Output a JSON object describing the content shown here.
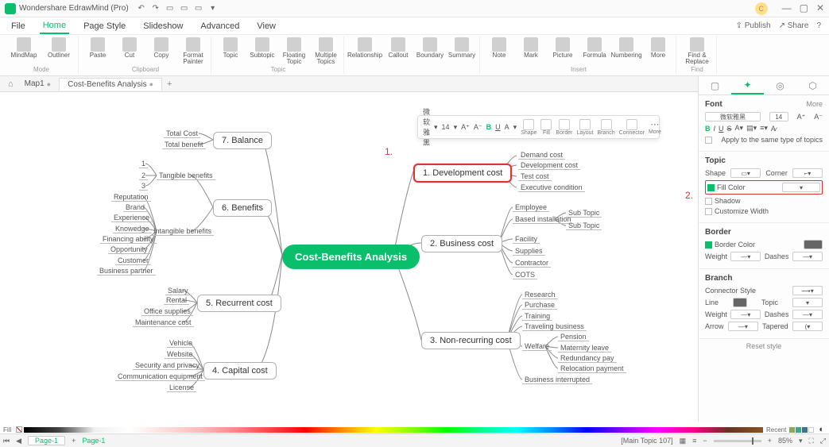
{
  "app": {
    "title": "Wondershare EdrawMind (Pro)"
  },
  "menu": {
    "file": "File",
    "home": "Home",
    "page_style": "Page Style",
    "slideshow": "Slideshow",
    "advanced": "Advanced",
    "view": "View",
    "publish": "Publish",
    "share": "Share"
  },
  "ribbon": {
    "mode": "Mode",
    "mindmap": "MindMap",
    "outliner": "Outliner",
    "clipboard": "Clipboard",
    "paste": "Paste",
    "cut": "Cut",
    "copy": "Copy",
    "format_painter": "Format Painter",
    "topic_group": "Topic",
    "topic": "Topic",
    "subtopic": "Subtopic",
    "floating": "Floating Topic",
    "multiple": "Multiple Topics",
    "relationship": "Relationship",
    "callout": "Callout",
    "boundary": "Boundary",
    "summary": "Summary",
    "insert": "Insert",
    "note": "Note",
    "mark": "Mark",
    "picture": "Picture",
    "formula": "Formula",
    "numbering": "Numbering",
    "more": "More",
    "find": "Find",
    "find_replace": "Find & Replace"
  },
  "tabs": {
    "map1": "Map1",
    "cba": "Cost-Benefits Analysis"
  },
  "float": {
    "font": "微软雅黑",
    "size": "14",
    "shape": "Shape",
    "fill": "Fill",
    "border": "Border",
    "layout": "Layout",
    "branch": "Branch",
    "connector": "Connector",
    "more": "More"
  },
  "rp": {
    "font": "Font",
    "more": "More",
    "font_name": "微软雅黑",
    "font_size": "14",
    "apply_same": "Apply to the same type of topics",
    "topic": "Topic",
    "shape": "Shape",
    "corner": "Corner",
    "fill_color": "Fill Color",
    "shadow": "Shadow",
    "customize_width": "Customize Width",
    "border": "Border",
    "border_color": "Border Color",
    "weight": "Weight",
    "dashes": "Dashes",
    "branch": "Branch",
    "connector_style": "Connector Style",
    "line": "Line",
    "topic_lbl": "Topic",
    "arrow": "Arrow",
    "tapered": "Tapered",
    "reset": "Reset style"
  },
  "annot": {
    "n1": "1.",
    "n2": "2."
  },
  "mm": {
    "root": "Cost-Benefits Analysis",
    "r1": "1. Development cost",
    "r1a": "Demand cost",
    "r1b": "Development cost",
    "r1c": "Test cost",
    "r1d": "Executive condition",
    "r2": "2. Business cost",
    "r2a": "Employee",
    "r2b": "Based installation",
    "r2b1": "Sub Topic",
    "r2b2": "Sub Topic",
    "r2c": "Facility",
    "r2d": "Supplies",
    "r2e": "Contractor",
    "r2f": "COTS",
    "r3": "3. Non-recurring cost",
    "r3a": "Research",
    "r3b": "Purchase",
    "r3c": "Training",
    "r3d": "Traveling business",
    "r3e": "Welfare",
    "r3e1": "Pension",
    "r3e2": "Maternity leave",
    "r3e3": "Redundancy pay",
    "r3e4": "Relocation payment",
    "r3f": "Business interrupted",
    "l4": "4. Capital cost",
    "l4a": "Vehicle",
    "l4b": "Website",
    "l4c": "Security and privacy",
    "l4d": "Communication equipment",
    "l4e": "License",
    "l5": "5. Recurrent cost",
    "l5a": "Salary",
    "l5b": "Rental",
    "l5c": "Office supplies",
    "l5d": "Maintenance cost",
    "l6": "6. Benefits",
    "l6t": "Tangible benefits",
    "l6t1": "1",
    "l6t2": "2",
    "l6t3": "3",
    "l6i": "Intangible benefits",
    "l6ia": "Reputation",
    "l6ib": "Brand",
    "l6ic": "Experience",
    "l6id": "Knowedge",
    "l6ie": "Financing ability",
    "l6if": "Opportunity",
    "l6ig": "Customer",
    "l6ih": "Business partner",
    "l7": "7. Balance",
    "l7a": "Total Cost",
    "l7b": "Total benefit"
  },
  "colorbar": {
    "fill": "Fill",
    "recent": "Recent"
  },
  "status": {
    "page": "Page-1",
    "page_link": "Page-1",
    "main_topic": "[Main Topic 107]",
    "zoom": "85%"
  }
}
